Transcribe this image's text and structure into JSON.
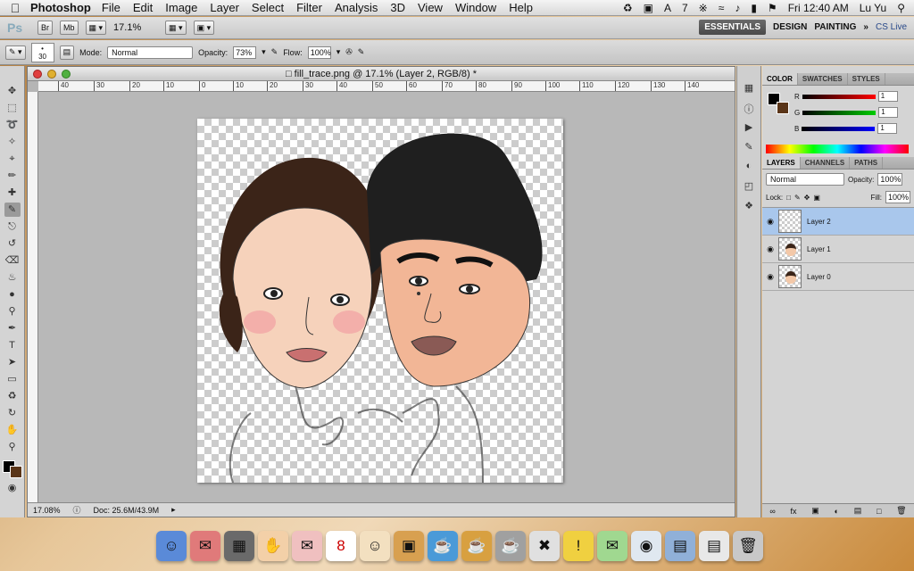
{
  "menubar": {
    "apple": "",
    "app_name": "Photoshop",
    "items": [
      "File",
      "Edit",
      "Image",
      "Layer",
      "Select",
      "Filter",
      "Analysis",
      "3D",
      "View",
      "Window",
      "Help"
    ],
    "status": {
      "adobe_count": "7",
      "datetime": "Fri 12:40 AM",
      "user": "Lu Yu"
    }
  },
  "appbar": {
    "logo": "Ps",
    "br_label": "Br",
    "mb_label": "Mb",
    "zoom": "17.1%",
    "workspaces": [
      "ESSENTIALS",
      "DESIGN",
      "PAINTING"
    ],
    "more": "»",
    "cs_live": "CS Live"
  },
  "options": {
    "brush_size": "30",
    "mode_label": "Mode:",
    "mode_value": "Normal",
    "opacity_label": "Opacity:",
    "opacity_value": "73%",
    "flow_label": "Flow:",
    "flow_value": "100%"
  },
  "document": {
    "title": "fill_trace.png @ 17.1% (Layer 2, RGB/8) *",
    "ruler_ticks": [
      "40",
      "30",
      "20",
      "10",
      "0",
      "10",
      "20",
      "30",
      "40",
      "50",
      "60",
      "70",
      "80",
      "90",
      "100",
      "110",
      "120",
      "130",
      "140"
    ],
    "status_zoom": "17.08%",
    "status_doc": "Doc: 25.6M/43.9M"
  },
  "color_panel": {
    "tabs": [
      "COLOR",
      "SWATCHES",
      "STYLES"
    ],
    "channels": [
      {
        "label": "R",
        "value": "1"
      },
      {
        "label": "G",
        "value": "1"
      },
      {
        "label": "B",
        "value": "1"
      }
    ]
  },
  "layers_panel": {
    "tabs": [
      "LAYERS",
      "CHANNELS",
      "PATHS"
    ],
    "blend_mode": "Normal",
    "opacity_label": "Opacity:",
    "opacity_value": "100%",
    "lock_label": "Lock:",
    "fill_label": "Fill:",
    "fill_value": "100%",
    "layers": [
      {
        "name": "Layer 2",
        "active": true
      },
      {
        "name": "Layer 1",
        "active": false
      },
      {
        "name": "Layer 0",
        "active": false
      }
    ]
  },
  "colors": {
    "foreground": "#000000",
    "background": "#5a3518",
    "active_layer": "#a9c7ec"
  }
}
